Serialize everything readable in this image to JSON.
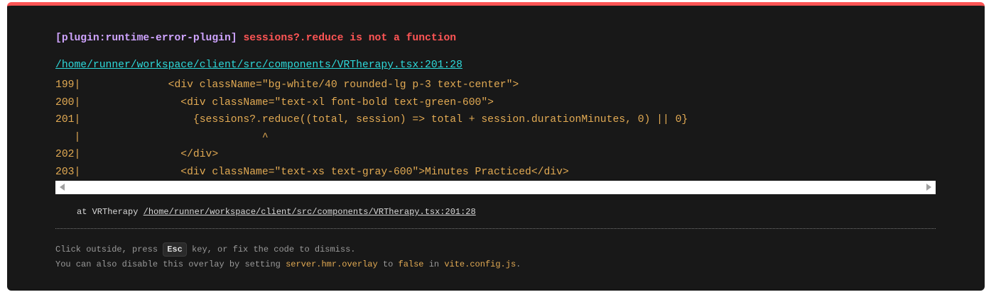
{
  "error": {
    "plugin": "[plugin:runtime-error-plugin]",
    "message": "sessions?.reduce is not a function",
    "file": "/home/runner/workspace/client/src/components/VRTherapy.tsx:201:28"
  },
  "frame": [
    "199|              <div className=\"bg-white/40 rounded-lg p-3 text-center\">",
    "200|                <div className=\"text-xl font-bold text-green-600\">",
    "201|                  {sessions?.reduce((total, session) => total + session.durationMinutes, 0) || 0}",
    "   |                             ^",
    "202|                </div>",
    "203|                <div className=\"text-xs text-gray-600\">Minutes Practiced</div>"
  ],
  "stack": {
    "prefix": "at VRTherapy ",
    "path": "/home/runner/workspace/client/src/components/VRTherapy.tsx:201:28"
  },
  "tip": {
    "line1_a": "Click outside, press ",
    "key": "Esc",
    "line1_b": " key, or fix the code to dismiss.",
    "line2_a": "You can also disable this overlay by setting ",
    "setting": "server.hmr.overlay",
    "line2_b": " to ",
    "value": "false",
    "line2_c": " in ",
    "config": "vite.config.js",
    "line2_d": "."
  },
  "colors": {
    "accent": "#ff5555",
    "plugin": "#cfa4ff",
    "link": "#2dd9da",
    "code": "#e2aa53"
  }
}
